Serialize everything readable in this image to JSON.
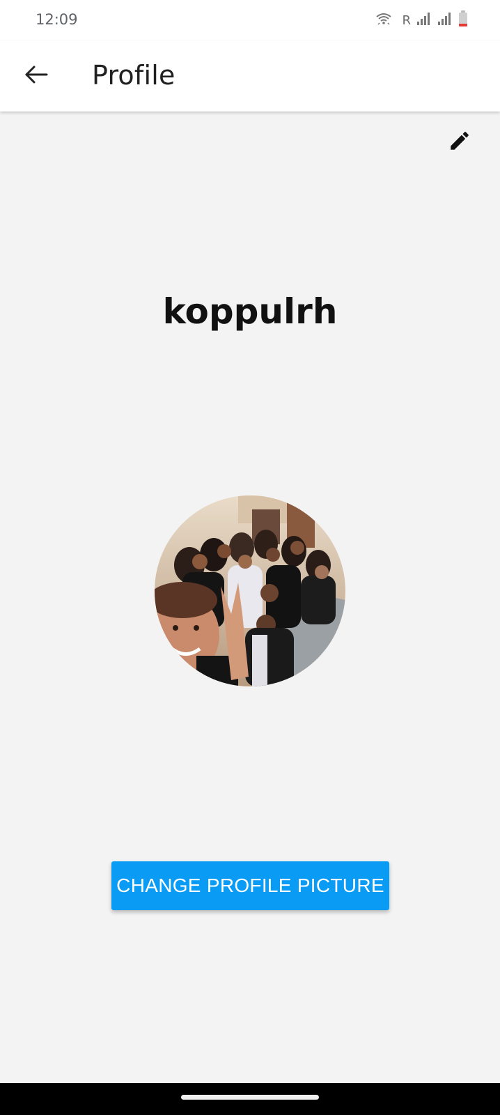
{
  "status_bar": {
    "time": "12:09",
    "roaming_label": "R",
    "icons": [
      "wifi-icon",
      "signal-icon",
      "signal-icon",
      "battery-low-icon"
    ],
    "battery_color": "#e53935"
  },
  "app_bar": {
    "title": "Profile",
    "back_icon": "arrow-back-icon"
  },
  "profile": {
    "username": "koppulrh",
    "edit_icon": "pencil-icon",
    "avatar_alt": "group selfie photo"
  },
  "actions": {
    "change_picture_label": "CHANGE PROFILE PICTURE"
  },
  "colors": {
    "accent": "#0a9bf5",
    "background": "#f3f3f3"
  }
}
